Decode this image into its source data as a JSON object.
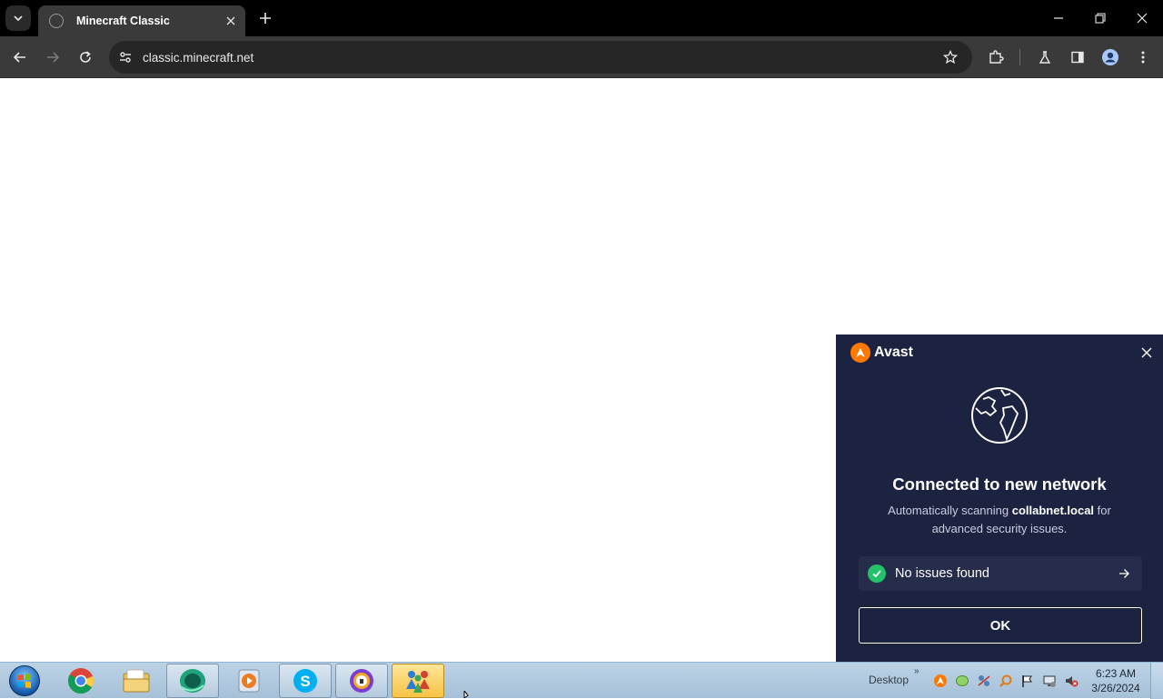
{
  "browser": {
    "tab_title": "Minecraft Classic",
    "url": "classic.minecraft.net"
  },
  "avast": {
    "brand": "Avast",
    "title": "Connected to new network",
    "desc_prefix": "Automatically scanning ",
    "network_name": "collabnet.local",
    "desc_suffix": " for advanced security issues.",
    "status": "No issues found",
    "ok_label": "OK",
    "accent_color": "#ff7800",
    "background_color": "#1c2341",
    "success_color": "#24c06a"
  },
  "taskbar": {
    "desktop_label": "Desktop",
    "overflow_chevron": "»",
    "time": "6:23 AM",
    "date": "3/26/2024",
    "apps": [
      "chrome-icon",
      "file-explorer-icon",
      "browser-app-icon",
      "media-player-icon",
      "skype-icon",
      "vpn-icon",
      "network-users-icon"
    ]
  }
}
